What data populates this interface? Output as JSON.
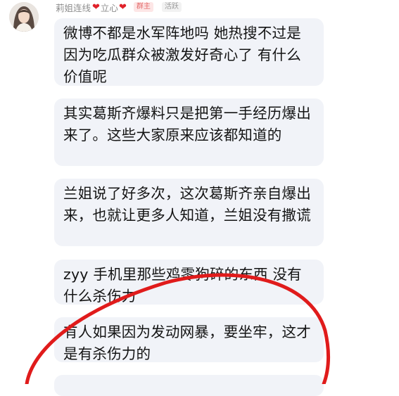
{
  "sender": {
    "nickname": "莉姐连线",
    "heart_1": "❤",
    "nick_suffix": "立心",
    "heart_2": "❤",
    "role_badge": "群主",
    "activity_badge": "活跃"
  },
  "messages": [
    {
      "text": "微博不都是水军阵地吗 她热搜不过是因为吃瓜群众被激发好奇心了 有什么价值呢"
    },
    {
      "text": "其实葛斯齐爆料只是把第一手经历爆出来了。这些大家原来应该都知道的"
    },
    {
      "text": "兰姐说了好多次，这次葛斯齐亲自爆出来，也就让更多人知道，兰姐没有撒谎"
    },
    {
      "text": "zyy 手机里那些鸡零狗碎的东西 没有什么杀伤力"
    },
    {
      "text": "有人如果因为发动网暴，要坐牢，这才是有杀伤力的"
    },
    {
      "text": ""
    }
  ],
  "colors": {
    "bubble": "#f1f3f8",
    "annotation_circle": "#e01b1b",
    "heart": "#e0222a"
  }
}
